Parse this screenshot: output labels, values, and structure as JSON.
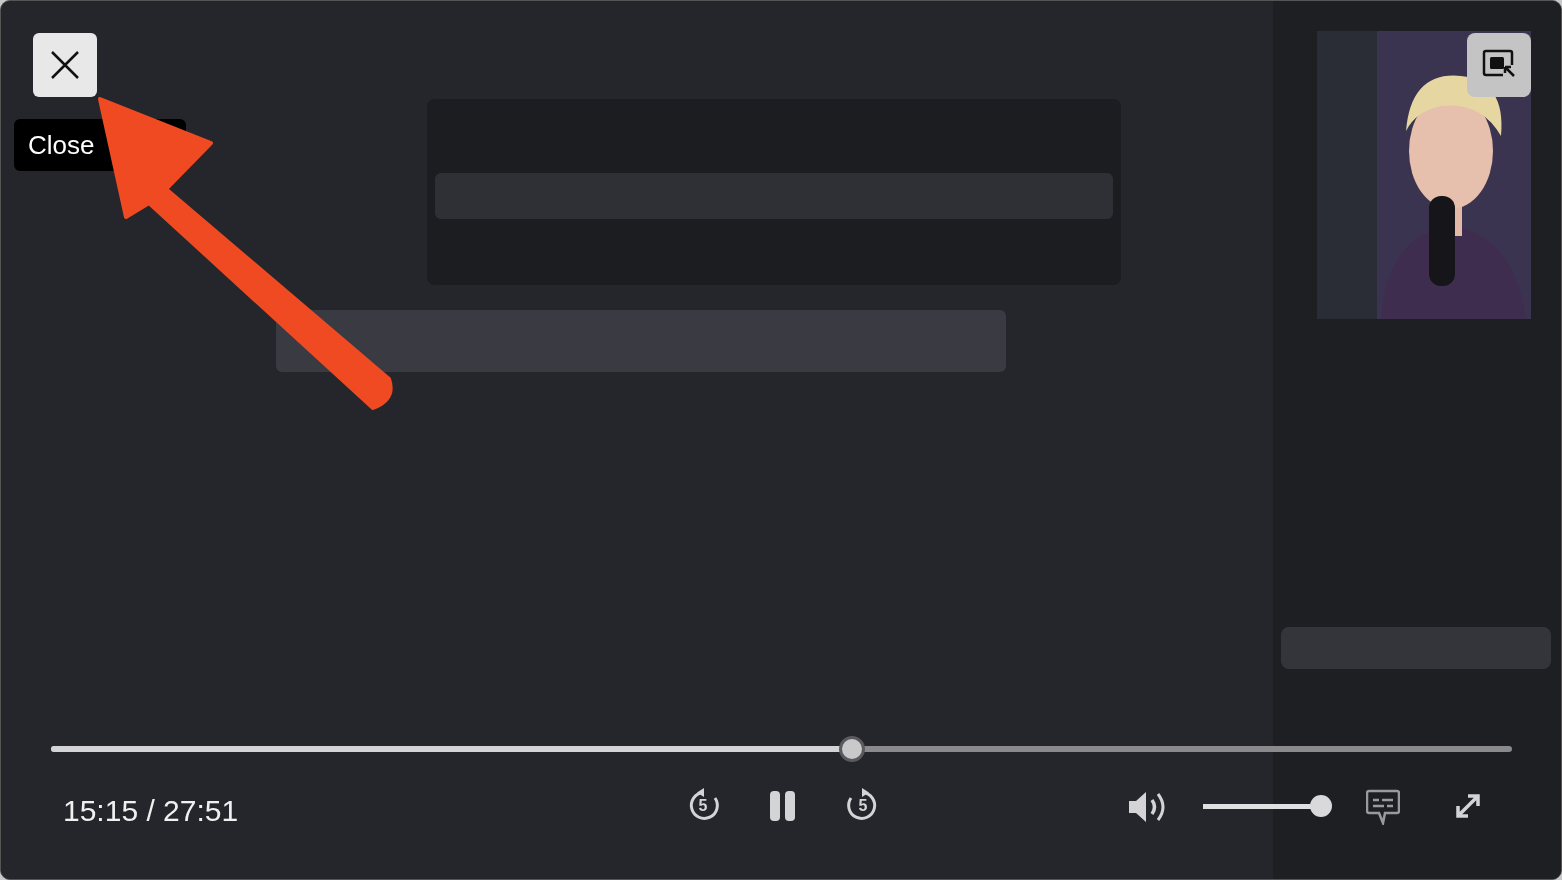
{
  "player": {
    "close_button": {
      "tooltip": "Close"
    },
    "progress": {
      "level": 0.548
    },
    "time": "15:15 / 27:51",
    "skip_back": {
      "label": "5"
    },
    "skip_forward": {
      "label": "5"
    },
    "playing": true,
    "volume": {
      "level": 0.92
    }
  }
}
